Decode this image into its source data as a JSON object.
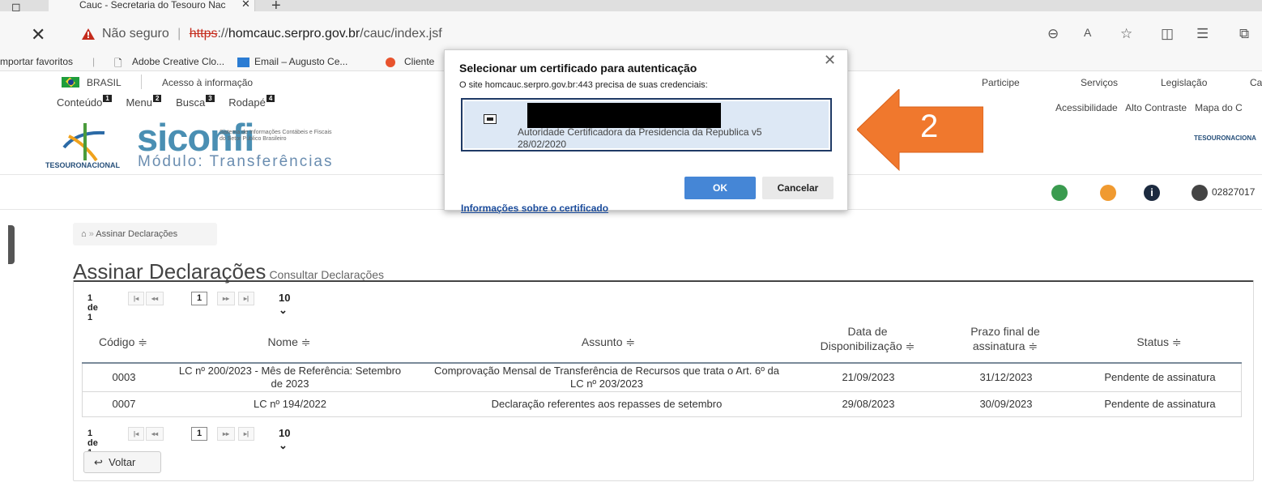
{
  "browser": {
    "tab_title": "Cauc - Secretaria do Tesouro Nac",
    "new_tab_icon": "plus-icon",
    "security_label": "Não seguro",
    "url_scheme": "https",
    "url_host": "homcauc.serpro.gov.br",
    "url_path": "/cauc/index.jsf",
    "favorites": [
      "mportar favoritos",
      "Adobe Creative Clo...",
      "Email – Augusto Ce...",
      "Cliente"
    ]
  },
  "gov_bar": {
    "country": "BRASIL",
    "access_info": "Acesso à informação",
    "right_links": [
      "Participe",
      "Serviços",
      "Legislação",
      "Ca"
    ]
  },
  "accessibility": {
    "items": [
      {
        "label": "Conteúdo",
        "key": "1"
      },
      {
        "label": "Menu",
        "key": "2"
      },
      {
        "label": "Busca",
        "key": "3"
      },
      {
        "label": "Rodapé",
        "key": "4"
      }
    ],
    "right_items": [
      "Acessibilidade",
      "Alto Contraste",
      "Mapa do C"
    ]
  },
  "branding": {
    "logo_word": "siconfi",
    "logo_sub": "Sistema de Informações Contábeis e Fiscais do Setor Público Brasileiro",
    "module": "Módulo: Transferências",
    "tesouro_left": "TESOURONACIONAL",
    "tesouro_right": "TESOURONACIONA"
  },
  "user": {
    "id_prefix": "02827017"
  },
  "breadcrumb": {
    "home_icon": "home-icon",
    "label": "Assinar Declarações"
  },
  "page": {
    "title": "Assinar Declarações",
    "subtitle": "Consultar Declarações"
  },
  "pager": {
    "summary": "1 de 1",
    "current": "1",
    "rows_per_page": "10"
  },
  "table": {
    "headers": {
      "codigo": "Código ≑",
      "nome": "Nome ≑",
      "assunto": "Assunto ≑",
      "data1": "Data de",
      "data2": "Disponibilização ≑",
      "prazo1": "Prazo final de",
      "prazo2": "assinatura ≑",
      "status": "Status ≑"
    },
    "rows": [
      {
        "codigo": "0003",
        "nome1": "LC nº 200/2023 - Mês de Referência: Setembro",
        "nome2": "de 2023",
        "assunto1": "Comprovação Mensal de Transferência de Recursos que trata o Art. 6º da",
        "assunto2": "LC nº 203/2023",
        "data": "21/09/2023",
        "prazo": "31/12/2023",
        "status": "Pendente de assinatura"
      },
      {
        "codigo": "0007",
        "nome": "LC nº 194/2022",
        "assunto": "Declaração referentes aos repasses de setembro",
        "data": "29/08/2023",
        "prazo": "30/09/2023",
        "status": "Pendente de assinatura"
      }
    ]
  },
  "back_button": "Voltar",
  "dialog": {
    "title": "Selecionar um certificado para autenticação",
    "text": "O site homcauc.serpro.gov.br:443 precisa de suas credenciais:",
    "cert_name": "Autoridade Certificadora da Presidencia da Republica v5",
    "cert_date": "28/02/2020",
    "info_link": "Informações sobre o certificado",
    "ok": "OK",
    "cancel": "Cancelar"
  },
  "annotation": {
    "number": "2",
    "color": "#f0782d"
  }
}
